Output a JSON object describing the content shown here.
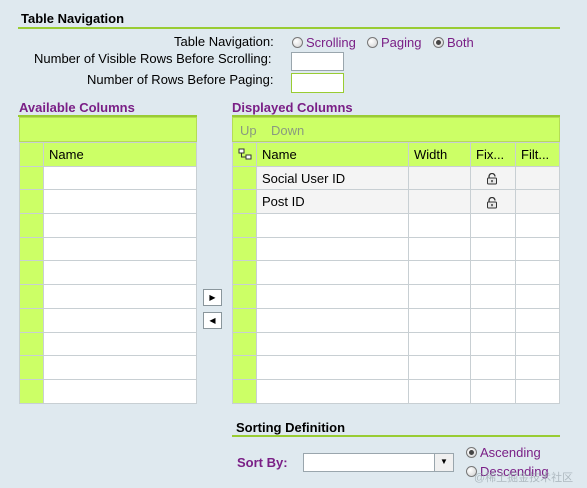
{
  "table_navigation": {
    "title": "Table Navigation",
    "label": "Table Navigation:",
    "options": [
      {
        "label": "Scrolling",
        "selected": false
      },
      {
        "label": "Paging",
        "selected": false
      },
      {
        "label": "Both",
        "selected": true
      }
    ],
    "visible_rows_label": "Number of Visible Rows Before Scrolling:",
    "visible_rows_value": "",
    "rows_before_paging_label": "Number of Rows Before Paging:",
    "rows_before_paging_value": ""
  },
  "available_columns": {
    "title": "Available Columns",
    "header_name": "Name",
    "rows": [
      "",
      "",
      "",
      "",
      "",
      "",
      "",
      "",
      "",
      ""
    ]
  },
  "move_buttons": {
    "right": "▶",
    "left": "◀"
  },
  "displayed_columns": {
    "title": "Displayed Columns",
    "toolbar": {
      "up": "Up",
      "down": "Down"
    },
    "headers": {
      "name": "Name",
      "width": "Width",
      "fixed": "Fix...",
      "filter": "Filt..."
    },
    "rows": [
      {
        "name": "Social User ID",
        "width": "",
        "fixed_icon": "lock-icon",
        "filter": ""
      },
      {
        "name": "Post ID",
        "width": "",
        "fixed_icon": "lock-icon",
        "filter": ""
      }
    ]
  },
  "sorting": {
    "title": "Sorting Definition",
    "sort_by_label": "Sort By:",
    "sort_by_value": "",
    "options": [
      {
        "label": "Ascending",
        "selected": true
      },
      {
        "label": "Descending",
        "selected": false
      }
    ]
  },
  "watermark": "@稀土掘金技术社区",
  "colors": {
    "accent": "#ccff66",
    "rule": "#99cc33",
    "title_purple": "#7a1f86",
    "background": "#dfe9ef"
  }
}
